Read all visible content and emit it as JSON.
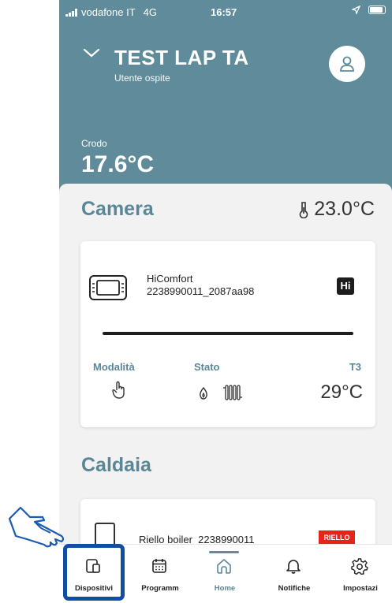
{
  "status_bar": {
    "carrier": "vodafone IT",
    "network": "4G",
    "time": "16:57"
  },
  "header": {
    "title": "TEST LAP TA",
    "subtitle": "Utente ospite"
  },
  "outside": {
    "label": "Crodo",
    "temperature": "17.6°C"
  },
  "room": {
    "name": "Camera",
    "temperature": "23.0°C"
  },
  "device_card": {
    "name": "HiComfort",
    "serial": "2238990011_2087aa98",
    "badge": "Hi",
    "labels": {
      "mode": "Modalità",
      "state": "Stato",
      "t3": "T3"
    },
    "t3_value": "29°C"
  },
  "section2": {
    "title": "Caldaia"
  },
  "boiler_card": {
    "name": "Riello boiler_2238990011",
    "brand": "RIELLO"
  },
  "tabs": [
    {
      "label": "Dispositivi",
      "icon": "devices-icon"
    },
    {
      "label": "Programm",
      "icon": "calendar-icon"
    },
    {
      "label": "Home",
      "icon": "home-icon"
    },
    {
      "label": "Notifiche",
      "icon": "bell-icon"
    },
    {
      "label": "Impostazi",
      "icon": "gear-icon"
    }
  ],
  "colors": {
    "header_bg": "#5f8b9a",
    "accent": "#5a8797",
    "highlight": "#0f4ea0",
    "brand_red": "#e8231c"
  }
}
